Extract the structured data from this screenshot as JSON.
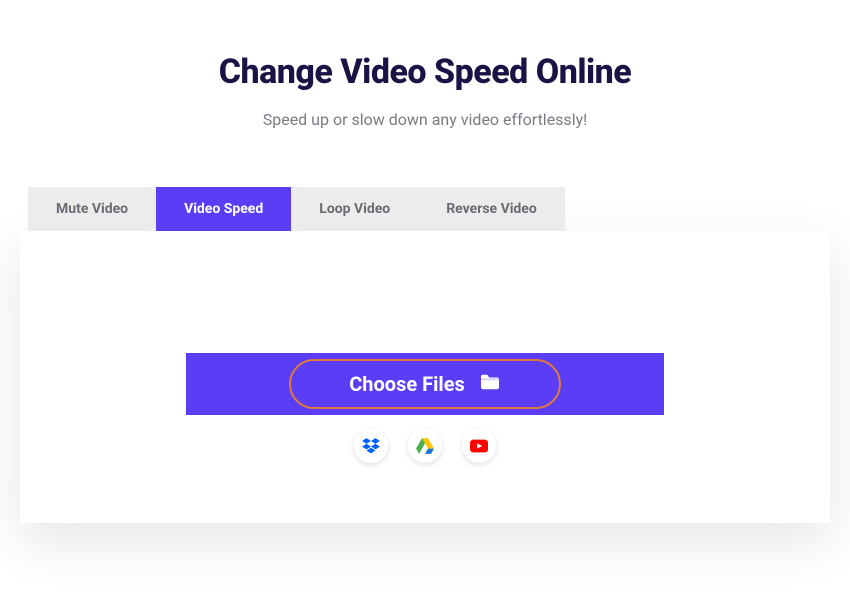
{
  "header": {
    "title": "Change Video Speed Online",
    "subtitle": "Speed up or slow down any video effortlessly!"
  },
  "tabs": {
    "mute": "Mute Video",
    "speed": "Video Speed",
    "loop": "Loop Video",
    "reverse": "Reverse Video"
  },
  "uploader": {
    "choose_label": "Choose Files"
  },
  "sources": {
    "dropbox": "Dropbox",
    "gdrive": "Google Drive",
    "youtube": "YouTube"
  },
  "colors": {
    "accent": "#5b3df5",
    "highlight_ring": "#e07a3a"
  }
}
